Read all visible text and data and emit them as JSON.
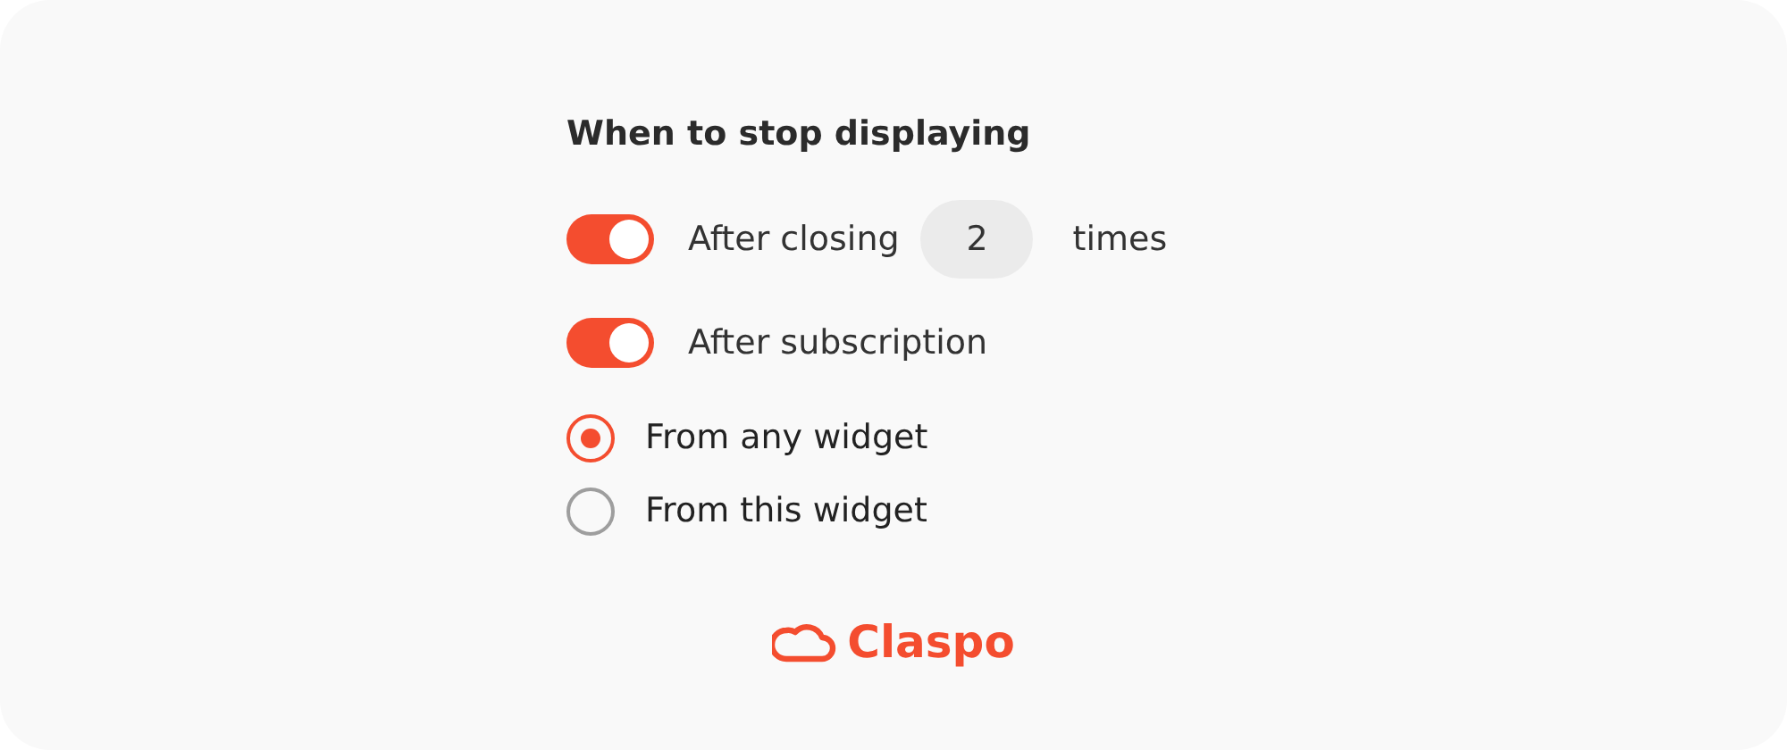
{
  "title": "When to stop displaying",
  "toggles": [
    {
      "kind": "count",
      "label": "After closing",
      "value": "2",
      "suffix": "times",
      "on": true
    },
    {
      "kind": "plain",
      "label": "After subscription",
      "on": true
    }
  ],
  "radios": [
    {
      "label": "From any widget",
      "selected": true
    },
    {
      "label": "From this widget",
      "selected": false
    }
  ],
  "brand": "Claspo"
}
